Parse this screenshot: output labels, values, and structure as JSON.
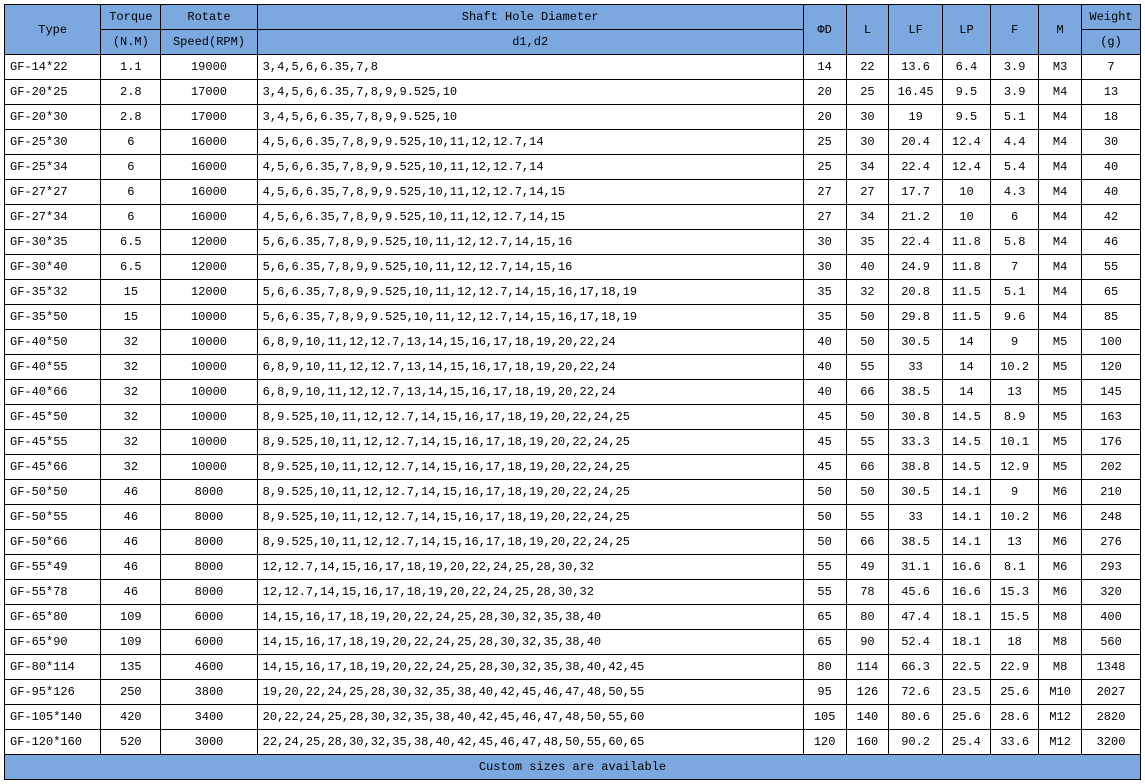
{
  "headers": {
    "type": "Type",
    "torque1": "Torque",
    "torque2": "(N.M)",
    "speed1": "Rotate",
    "speed2": "Speed(RPM)",
    "shaft1": "Shaft Hole Diameter",
    "shaft2": "d1,d2",
    "phid": "ΦD",
    "l": "L",
    "lf": "LF",
    "lp": "LP",
    "f": "F",
    "m": "M",
    "weight1": "Weight",
    "weight2": "(g)"
  },
  "rows": [
    {
      "type": "GF-14*22",
      "torque": "1.1",
      "speed": "19000",
      "shaft": "3,4,5,6,6.35,7,8",
      "phid": "14",
      "l": "22",
      "lf": "13.6",
      "lp": "6.4",
      "f": "3.9",
      "m": "M3",
      "weight": "7"
    },
    {
      "type": "GF-20*25",
      "torque": "2.8",
      "speed": "17000",
      "shaft": "3,4,5,6,6.35,7,8,9,9.525,10",
      "phid": "20",
      "l": "25",
      "lf": "16.45",
      "lp": "9.5",
      "f": "3.9",
      "m": "M4",
      "weight": "13"
    },
    {
      "type": "GF-20*30",
      "torque": "2.8",
      "speed": "17000",
      "shaft": "3,4,5,6,6.35,7,8,9,9.525,10",
      "phid": "20",
      "l": "30",
      "lf": "19",
      "lp": "9.5",
      "f": "5.1",
      "m": "M4",
      "weight": "18"
    },
    {
      "type": "GF-25*30",
      "torque": "6",
      "speed": "16000",
      "shaft": "4,5,6,6.35,7,8,9,9.525,10,11,12,12.7,14",
      "phid": "25",
      "l": "30",
      "lf": "20.4",
      "lp": "12.4",
      "f": "4.4",
      "m": "M4",
      "weight": "30"
    },
    {
      "type": "GF-25*34",
      "torque": "6",
      "speed": "16000",
      "shaft": "4,5,6,6.35,7,8,9,9.525,10,11,12,12.7,14",
      "phid": "25",
      "l": "34",
      "lf": "22.4",
      "lp": "12.4",
      "f": "5.4",
      "m": "M4",
      "weight": "40"
    },
    {
      "type": "GF-27*27",
      "torque": "6",
      "speed": "16000",
      "shaft": "4,5,6,6.35,7,8,9,9.525,10,11,12,12.7,14,15",
      "phid": "27",
      "l": "27",
      "lf": "17.7",
      "lp": "10",
      "f": "4.3",
      "m": "M4",
      "weight": "40"
    },
    {
      "type": "GF-27*34",
      "torque": "6",
      "speed": "16000",
      "shaft": "4,5,6,6.35,7,8,9,9.525,10,11,12,12.7,14,15",
      "phid": "27",
      "l": "34",
      "lf": "21.2",
      "lp": "10",
      "f": "6",
      "m": "M4",
      "weight": "42"
    },
    {
      "type": "GF-30*35",
      "torque": "6.5",
      "speed": "12000",
      "shaft": "5,6,6.35,7,8,9,9.525,10,11,12,12.7,14,15,16",
      "phid": "30",
      "l": "35",
      "lf": "22.4",
      "lp": "11.8",
      "f": "5.8",
      "m": "M4",
      "weight": "46"
    },
    {
      "type": "GF-30*40",
      "torque": "6.5",
      "speed": "12000",
      "shaft": "5,6,6.35,7,8,9,9.525,10,11,12,12.7,14,15,16",
      "phid": "30",
      "l": "40",
      "lf": "24.9",
      "lp": "11.8",
      "f": "7",
      "m": "M4",
      "weight": "55"
    },
    {
      "type": "GF-35*32",
      "torque": "15",
      "speed": "12000",
      "shaft": "5,6,6.35,7,8,9,9.525,10,11,12,12.7,14,15,16,17,18,19",
      "phid": "35",
      "l": "32",
      "lf": "20.8",
      "lp": "11.5",
      "f": "5.1",
      "m": "M4",
      "weight": "65"
    },
    {
      "type": "GF-35*50",
      "torque": "15",
      "speed": "10000",
      "shaft": "5,6,6.35,7,8,9,9.525,10,11,12,12.7,14,15,16,17,18,19",
      "phid": "35",
      "l": "50",
      "lf": "29.8",
      "lp": "11.5",
      "f": "9.6",
      "m": "M4",
      "weight": "85"
    },
    {
      "type": "GF-40*50",
      "torque": "32",
      "speed": "10000",
      "shaft": "6,8,9,10,11,12,12.7,13,14,15,16,17,18,19,20,22,24",
      "phid": "40",
      "l": "50",
      "lf": "30.5",
      "lp": "14",
      "f": "9",
      "m": "M5",
      "weight": "100"
    },
    {
      "type": "GF-40*55",
      "torque": "32",
      "speed": "10000",
      "shaft": "6,8,9,10,11,12,12.7,13,14,15,16,17,18,19,20,22,24",
      "phid": "40",
      "l": "55",
      "lf": "33",
      "lp": "14",
      "f": "10.2",
      "m": "M5",
      "weight": "120"
    },
    {
      "type": "GF-40*66",
      "torque": "32",
      "speed": "10000",
      "shaft": "6,8,9,10,11,12,12.7,13,14,15,16,17,18,19,20,22,24",
      "phid": "40",
      "l": "66",
      "lf": "38.5",
      "lp": "14",
      "f": "13",
      "m": "M5",
      "weight": "145"
    },
    {
      "type": "GF-45*50",
      "torque": "32",
      "speed": "10000",
      "shaft": "8,9.525,10,11,12,12.7,14,15,16,17,18,19,20,22,24,25",
      "phid": "45",
      "l": "50",
      "lf": "30.8",
      "lp": "14.5",
      "f": "8.9",
      "m": "M5",
      "weight": "163"
    },
    {
      "type": "GF-45*55",
      "torque": "32",
      "speed": "10000",
      "shaft": "8,9.525,10,11,12,12.7,14,15,16,17,18,19,20,22,24,25",
      "phid": "45",
      "l": "55",
      "lf": "33.3",
      "lp": "14.5",
      "f": "10.1",
      "m": "M5",
      "weight": "176"
    },
    {
      "type": "GF-45*66",
      "torque": "32",
      "speed": "10000",
      "shaft": "8,9.525,10,11,12,12.7,14,15,16,17,18,19,20,22,24,25",
      "phid": "45",
      "l": "66",
      "lf": "38.8",
      "lp": "14.5",
      "f": "12.9",
      "m": "M5",
      "weight": "202"
    },
    {
      "type": "GF-50*50",
      "torque": "46",
      "speed": "8000",
      "shaft": "8,9.525,10,11,12,12.7,14,15,16,17,18,19,20,22,24,25",
      "phid": "50",
      "l": "50",
      "lf": "30.5",
      "lp": "14.1",
      "f": "9",
      "m": "M6",
      "weight": "210"
    },
    {
      "type": "GF-50*55",
      "torque": "46",
      "speed": "8000",
      "shaft": "8,9.525,10,11,12,12.7,14,15,16,17,18,19,20,22,24,25",
      "phid": "50",
      "l": "55",
      "lf": "33",
      "lp": "14.1",
      "f": "10.2",
      "m": "M6",
      "weight": "248"
    },
    {
      "type": "GF-50*66",
      "torque": "46",
      "speed": "8000",
      "shaft": "8,9.525,10,11,12,12.7,14,15,16,17,18,19,20,22,24,25",
      "phid": "50",
      "l": "66",
      "lf": "38.5",
      "lp": "14.1",
      "f": "13",
      "m": "M6",
      "weight": "276"
    },
    {
      "type": "GF-55*49",
      "torque": "46",
      "speed": "8000",
      "shaft": "12,12.7,14,15,16,17,18,19,20,22,24,25,28,30,32",
      "phid": "55",
      "l": "49",
      "lf": "31.1",
      "lp": "16.6",
      "f": "8.1",
      "m": "M6",
      "weight": "293"
    },
    {
      "type": "GF-55*78",
      "torque": "46",
      "speed": "8000",
      "shaft": "12,12.7,14,15,16,17,18,19,20,22,24,25,28,30,32",
      "phid": "55",
      "l": "78",
      "lf": "45.6",
      "lp": "16.6",
      "f": "15.3",
      "m": "M6",
      "weight": "320"
    },
    {
      "type": "GF-65*80",
      "torque": "109",
      "speed": "6000",
      "shaft": "14,15,16,17,18,19,20,22,24,25,28,30,32,35,38,40",
      "phid": "65",
      "l": "80",
      "lf": "47.4",
      "lp": "18.1",
      "f": "15.5",
      "m": "M8",
      "weight": "400"
    },
    {
      "type": "GF-65*90",
      "torque": "109",
      "speed": "6000",
      "shaft": "14,15,16,17,18,19,20,22,24,25,28,30,32,35,38,40",
      "phid": "65",
      "l": "90",
      "lf": "52.4",
      "lp": "18.1",
      "f": "18",
      "m": "M8",
      "weight": "560"
    },
    {
      "type": "GF-80*114",
      "torque": "135",
      "speed": "4600",
      "shaft": "14,15,16,17,18,19,20,22,24,25,28,30,32,35,38,40,42,45",
      "phid": "80",
      "l": "114",
      "lf": "66.3",
      "lp": "22.5",
      "f": "22.9",
      "m": "M8",
      "weight": "1348"
    },
    {
      "type": "GF-95*126",
      "torque": "250",
      "speed": "3800",
      "shaft": "19,20,22,24,25,28,30,32,35,38,40,42,45,46,47,48,50,55",
      "phid": "95",
      "l": "126",
      "lf": "72.6",
      "lp": "23.5",
      "f": "25.6",
      "m": "M10",
      "weight": "2027"
    },
    {
      "type": "GF-105*140",
      "torque": "420",
      "speed": "3400",
      "shaft": "20,22,24,25,28,30,32,35,38,40,42,45,46,47,48,50,55,60",
      "phid": "105",
      "l": "140",
      "lf": "80.6",
      "lp": "25.6",
      "f": "28.6",
      "m": "M12",
      "weight": "2820"
    },
    {
      "type": "GF-120*160",
      "torque": "520",
      "speed": "3000",
      "shaft": "22,24,25,28,30,32,35,38,40,42,45,46,47,48,50,55,60,65",
      "phid": "120",
      "l": "160",
      "lf": "90.2",
      "lp": "25.4",
      "f": "33.6",
      "m": "M12",
      "weight": "3200"
    }
  ],
  "footer": "Custom sizes are available"
}
